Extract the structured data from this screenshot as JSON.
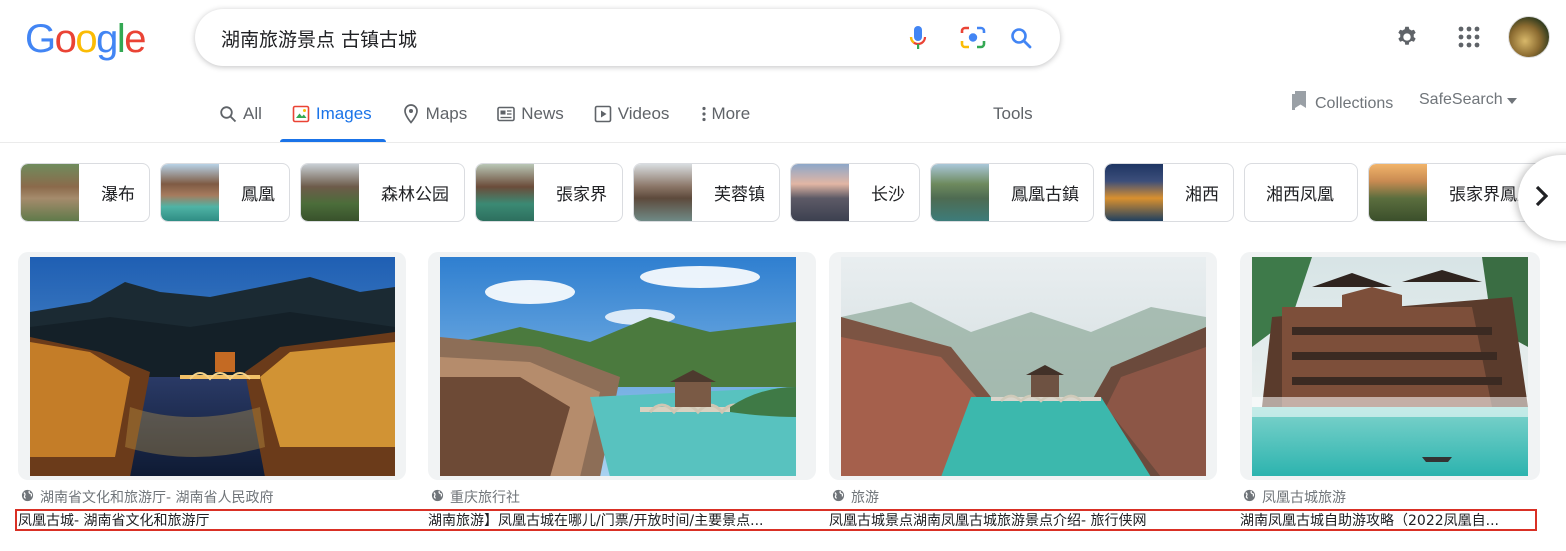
{
  "logo": {
    "text": "Google"
  },
  "search": {
    "query": "湖南旅游景点 古镇古城"
  },
  "icons": {
    "mic": "microphone-icon",
    "lens": "camera-lens-icon",
    "search": "search-icon",
    "settings": "gear-icon",
    "apps": "apps-grid-icon"
  },
  "tabs": [
    {
      "label": "All",
      "icon": "search-icon"
    },
    {
      "label": "Images",
      "icon": "image-icon",
      "active": true
    },
    {
      "label": "Maps",
      "icon": "map-pin-icon"
    },
    {
      "label": "News",
      "icon": "news-icon"
    },
    {
      "label": "Videos",
      "icon": "play-icon"
    },
    {
      "label": "More",
      "icon": "vertical-dots-icon"
    }
  ],
  "tools_label": "Tools",
  "collections_label": "Collections",
  "safesearch_label": "SafeSearch",
  "chips": [
    {
      "label": "瀑布"
    },
    {
      "label": "鳳凰"
    },
    {
      "label": "森林公园"
    },
    {
      "label": "張家界"
    },
    {
      "label": "芙蓉镇"
    },
    {
      "label": "长沙"
    },
    {
      "label": "鳳凰古鎮"
    },
    {
      "label": "湘西"
    },
    {
      "label": "湘西凤凰"
    },
    {
      "label": "張家界鳳凰"
    }
  ],
  "results": [
    {
      "source": "湖南省文化和旅游厅- 湖南省人民政府",
      "title": "凤凰古城- 湖南省文化和旅游厅"
    },
    {
      "source": "重庆旅行社",
      "title": "湖南旅游】凤凰古城在哪儿/门票/开放时间/主要景点..."
    },
    {
      "source": "旅游",
      "title": "凤凰古城景点湖南凤凰古城旅游景点介绍- 旅行侠网"
    },
    {
      "source": "凤凰古城旅游",
      "title": "湖南凤凰古城自助游攻略（2022凤凰自..."
    }
  ],
  "colors": {
    "accent": "#1a73e8",
    "highlight": "#d93025"
  }
}
